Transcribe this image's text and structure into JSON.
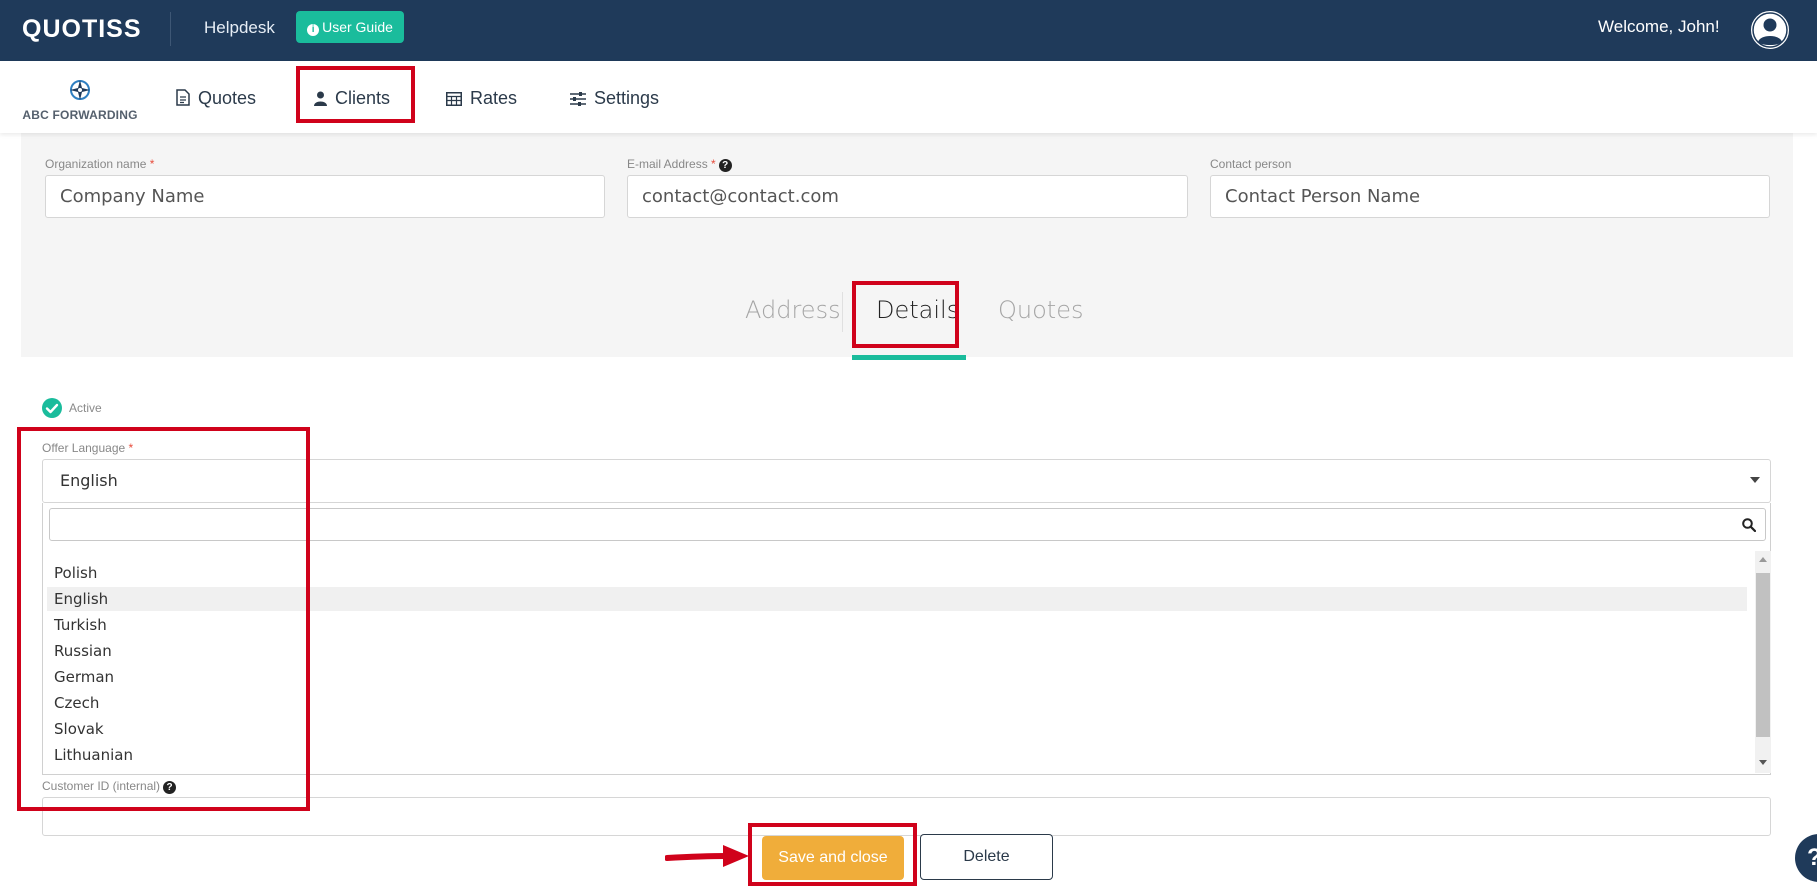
{
  "topbar": {
    "brand": "QUOTISS",
    "helpdesk": "Helpdesk",
    "user_guide": "User Guide",
    "welcome": "Welcome, John!"
  },
  "navbar": {
    "company_logo_text": "ABC FORWARDING",
    "items": [
      {
        "label": "Quotes"
      },
      {
        "label": "Clients"
      },
      {
        "label": "Rates"
      },
      {
        "label": "Settings"
      }
    ]
  },
  "client_form": {
    "organization": {
      "label": "Organization name",
      "required": "*",
      "value": "Company Name"
    },
    "email": {
      "label": "E-mail Address",
      "required": "*",
      "value": "contact@contact.com"
    },
    "contact": {
      "label": "Contact person",
      "value": "Contact Person Name"
    }
  },
  "tabs": [
    {
      "label": "Address"
    },
    {
      "label": "Details"
    },
    {
      "label": "Quotes"
    }
  ],
  "details": {
    "active_label": "Active",
    "offer_language": {
      "label": "Offer Language",
      "required": "*",
      "selected": "English",
      "search_value": "",
      "options": [
        "Polish",
        "English",
        "Turkish",
        "Russian",
        "German",
        "Czech",
        "Slovak",
        "Lithuanian"
      ]
    },
    "customer_id": {
      "label": "Customer ID (internal)",
      "value": ""
    }
  },
  "actions": {
    "save": "Save and close",
    "delete": "Delete"
  },
  "colors": {
    "topbar": "#1f3a5a",
    "accent": "#1abc9c",
    "save_button": "#f0ad3a",
    "annotation": "#d0021b"
  }
}
